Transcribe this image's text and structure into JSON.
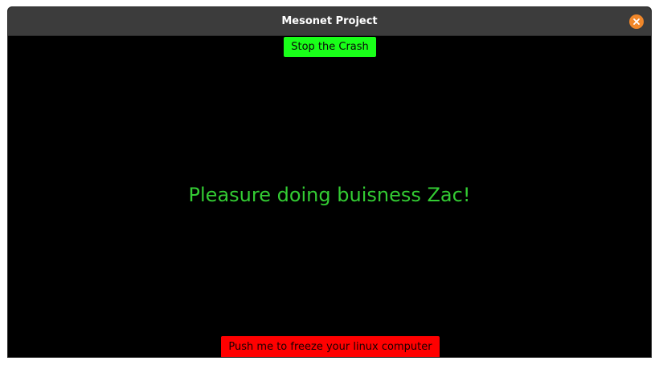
{
  "window": {
    "title": "Mesonet Project",
    "close_icon": "close-icon"
  },
  "main": {
    "stop_button_label": "Stop the Crash",
    "message": "Pleasure doing buisness Zac!",
    "freeze_button_label": "Push me to freeze your linux computer"
  },
  "colors": {
    "stop_button_bg": "#19ff19",
    "freeze_button_bg": "#ff0000",
    "message_text": "#33cc33",
    "close_button_bg": "#f0872a",
    "titlebar_bg": "#3c3c3c",
    "content_bg": "#000000"
  }
}
